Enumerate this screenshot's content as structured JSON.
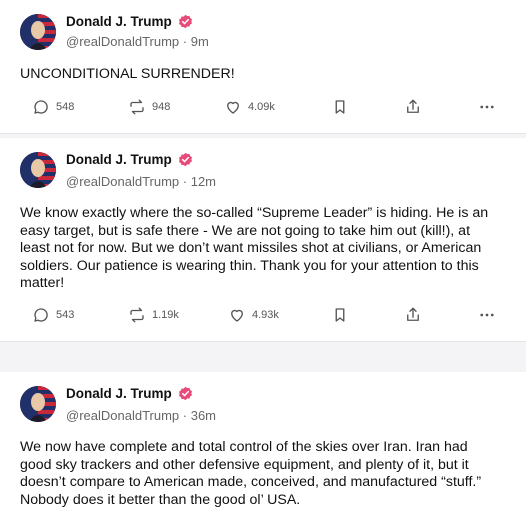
{
  "posts": [
    {
      "author": "Donald J. Trump",
      "handle": "@realDonaldTrump",
      "time": "9m",
      "text": "UNCONDITIONAL SURRENDER!",
      "stats": {
        "replies": "548",
        "reposts": "948",
        "likes": "4.09k"
      }
    },
    {
      "author": "Donald J. Trump",
      "handle": "@realDonaldTrump",
      "time": "12m",
      "text": "We know exactly where the so-called “Supreme Leader” is hiding. He is an easy target, but is safe there - We are not going to take him out (kill!), at least not for now. But we don’t want missiles shot at civilians, or American soldiers. Our patience is wearing thin. Thank you for your attention to this matter!",
      "stats": {
        "replies": "543",
        "reposts": "1.19k",
        "likes": "4.93k"
      }
    },
    {
      "author": "Donald J. Trump",
      "handle": "@realDonaldTrump",
      "time": "36m",
      "text": "We now have complete and total control of the skies over Iran. Iran had good sky trackers and other defensive equipment, and plenty of it, but it doesn’t compare to American made, conceived, and manufactured “stuff.” Nobody does it better than the good ol’ USA."
    }
  ],
  "separator": " · ",
  "colors": {
    "verified": "#e84a7a",
    "muted": "#666666",
    "icon": "#555555"
  }
}
